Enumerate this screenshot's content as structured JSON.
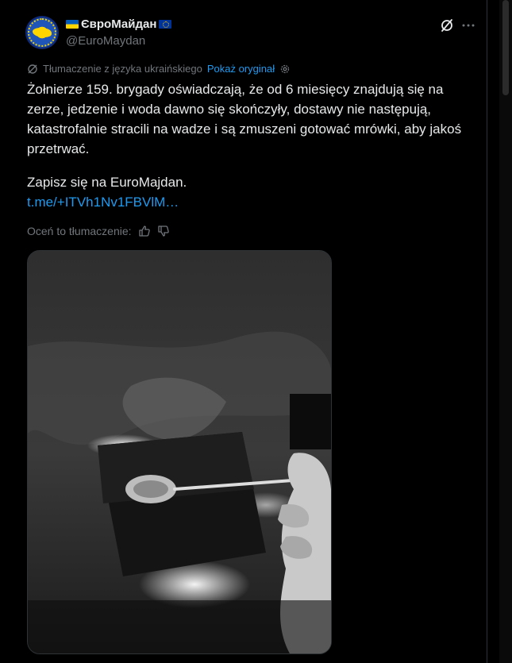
{
  "author": {
    "display_name": "ЄвроМайдан",
    "handle": "@EuroMaydan"
  },
  "translation": {
    "label": "Tłumaczenie z języka ukraińskiego",
    "show_original": "Pokaż oryginał"
  },
  "tweet": {
    "text": "Żołnierze 159. brygady oświadczają, że od 6 miesięcy znajdują się na zerze, jedzenie i woda dawno się skończyły, dostawy nie następują, katastrofalnie stracili na wadze i są zmuszeni gotować mrówki, aby jakoś przetrwać.",
    "cta": "Zapisz się na EuroMajdan.",
    "link": "t.me/+ITVh1Nv1FBVlM…"
  },
  "rating": {
    "label": "Oceń to tłumaczenie:"
  },
  "icons": {
    "grok": "grok-icon",
    "more": "more-icon",
    "translate": "translate-icon",
    "settings": "gear-icon",
    "like": "thumbs-up-icon",
    "dislike": "thumbs-down-icon"
  },
  "colors": {
    "background": "#000000",
    "text": "#e7e9ea",
    "muted": "#71767b",
    "link": "#1d9bf0",
    "border": "#2f3336"
  }
}
